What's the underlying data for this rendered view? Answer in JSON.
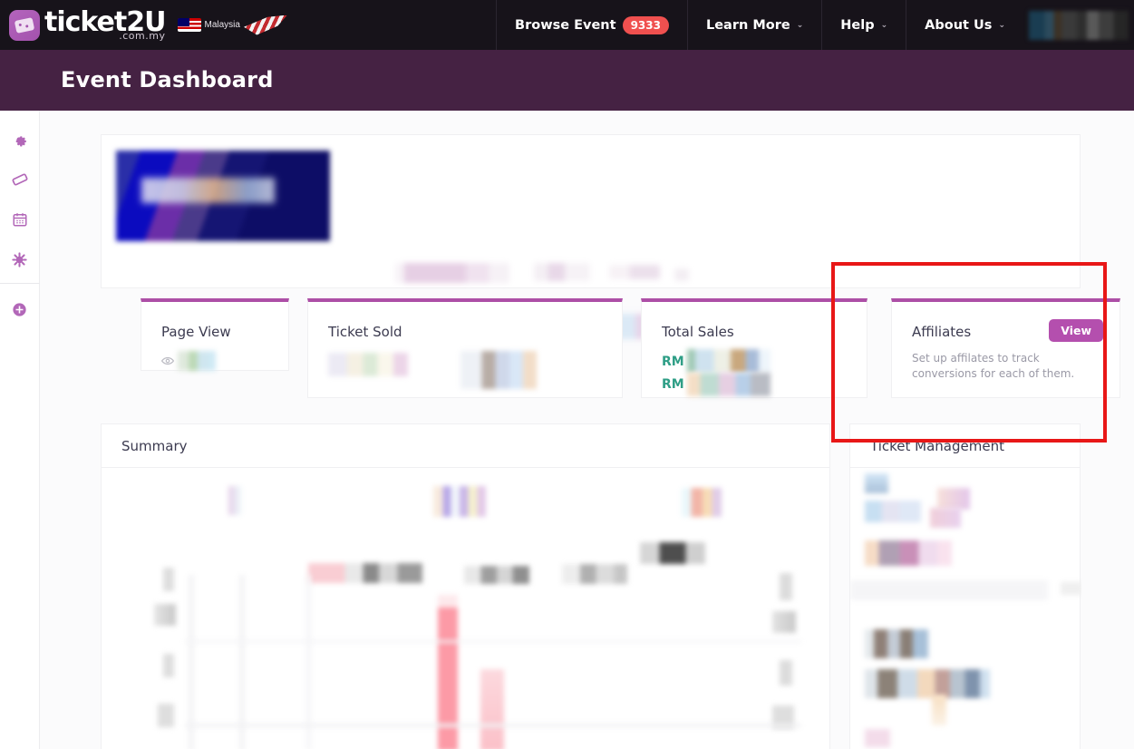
{
  "topnav": {
    "logo": {
      "word": "ticket2U",
      "domain": ".com.my",
      "icon": "ticket-logo-icon"
    },
    "region": {
      "label": "Malaysia",
      "icon": "malaysia-flag-icon"
    },
    "items": [
      {
        "label": "Browse Event",
        "badge": "9333",
        "caret": ""
      },
      {
        "label": "Learn More",
        "badge": "",
        "caret": "⌄"
      },
      {
        "label": "Help",
        "badge": "",
        "caret": "⌄"
      },
      {
        "label": "About Us",
        "badge": "",
        "caret": "⌄"
      }
    ]
  },
  "titlebar": {
    "title": "Event Dashboard"
  },
  "sidebar": {
    "items": [
      {
        "name": "settings",
        "glyph": "⚙"
      },
      {
        "name": "ticket",
        "glyph": "✉"
      },
      {
        "name": "calendar",
        "glyph": "Ὄ5"
      },
      {
        "name": "star",
        "glyph": "✻"
      },
      {
        "name": "add",
        "glyph": "⊕"
      }
    ]
  },
  "stats": {
    "page_view": {
      "label": "Page View",
      "icon": "eye-icon",
      "value": ""
    },
    "ticket_sold": {
      "label": "Ticket Sold",
      "value": ""
    },
    "total_sales": {
      "label": "Total Sales",
      "currency_1": "RM",
      "currency_2": "RM",
      "value_1": "",
      "value_2": ""
    },
    "affiliates": {
      "label": "Affiliates",
      "button": "View",
      "description": "Set up affilates to track conversions for each of them."
    }
  },
  "panels": {
    "summary": {
      "title": "Summary"
    },
    "ticket_management": {
      "title": "Ticket Management"
    }
  },
  "colors": {
    "topnav_bg": "#17131a",
    "titlebar_bg": "#452243",
    "accent_purple": "#ad4fa6",
    "badge_red": "#f0504f",
    "currency_green": "#2e9e86",
    "annotation_red": "#e81717"
  },
  "annotation": {
    "type": "highlight-rectangle",
    "target": "affiliates-card"
  }
}
